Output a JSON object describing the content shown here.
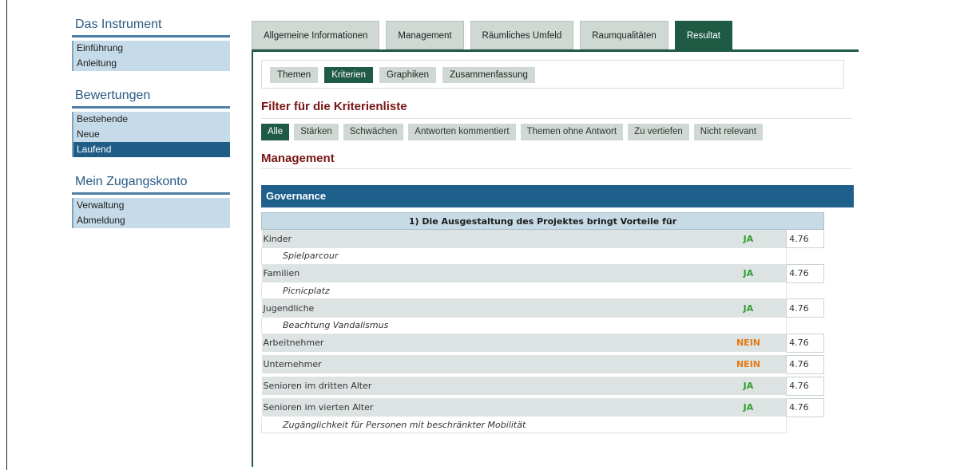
{
  "sidebar": {
    "sections": [
      {
        "title": "Das Instrument",
        "items": [
          {
            "label": "Einführung",
            "active": false
          },
          {
            "label": "Anleitung",
            "active": false
          }
        ]
      },
      {
        "title": "Bewertungen",
        "items": [
          {
            "label": "Bestehende",
            "active": false
          },
          {
            "label": "Neue",
            "active": false
          },
          {
            "label": "Laufend",
            "active": true
          }
        ]
      },
      {
        "title": "Mein Zugangskonto",
        "items": [
          {
            "label": "Verwaltung",
            "active": false
          },
          {
            "label": "Abmeldung",
            "active": false
          }
        ]
      }
    ]
  },
  "tabs": [
    {
      "label": "Allgemeine Informationen",
      "active": false
    },
    {
      "label": "Management",
      "active": false
    },
    {
      "label": "Räumliches Umfeld",
      "active": false
    },
    {
      "label": "Raumqualitäten",
      "active": false
    },
    {
      "label": "Resultat",
      "active": true
    }
  ],
  "subtabs": [
    {
      "label": "Themen",
      "active": false
    },
    {
      "label": "Kriterien",
      "active": true
    },
    {
      "label": "Graphiken",
      "active": false
    },
    {
      "label": "Zusammenfassung",
      "active": false
    }
  ],
  "filter_heading": "Filter für die Kriterienliste",
  "filters": [
    {
      "label": "Alle",
      "active": true
    },
    {
      "label": "Stärken",
      "active": false
    },
    {
      "label": "Schwächen",
      "active": false
    },
    {
      "label": "Antworten kommentiert",
      "active": false
    },
    {
      "label": "Themen ohne Antwort",
      "active": false
    },
    {
      "label": "Zu vertiefen",
      "active": false
    },
    {
      "label": "Nicht relevant",
      "active": false
    }
  ],
  "section_heading": "Management",
  "governance_title": "Governance",
  "criteria": {
    "question": "1) Die Ausgestaltung des Projektes bringt Vorteile für",
    "rows": [
      {
        "label": "Kinder",
        "answer": "JA",
        "score": "4.76",
        "comment": "Spielparcour"
      },
      {
        "label": "Familien",
        "answer": "JA",
        "score": "4.76",
        "comment": "Picnicplatz"
      },
      {
        "label": "Jugendliche",
        "answer": "JA",
        "score": "4.76",
        "comment": "Beachtung Vandalismus"
      },
      {
        "label": "Arbeitnehmer",
        "answer": "NEIN",
        "score": "4.76",
        "comment": ""
      },
      {
        "label": "Unternehmer",
        "answer": "NEIN",
        "score": "4.76",
        "comment": ""
      },
      {
        "label": "Senioren im dritten Alter",
        "answer": "JA",
        "score": "4.76",
        "comment": ""
      },
      {
        "label": "Senioren im vierten Alter",
        "answer": "JA",
        "score": "4.76",
        "comment": "Zugänglichkeit für Personen mit beschränkter Mobilität"
      }
    ]
  },
  "colors": {
    "sidebar_active": "#1f5d86",
    "tab_active": "#1f5a45",
    "heading": "#7a1515",
    "governance_bar": "#1e5f8c",
    "answer_yes": "#2e9f2e",
    "answer_no": "#e07a12"
  }
}
